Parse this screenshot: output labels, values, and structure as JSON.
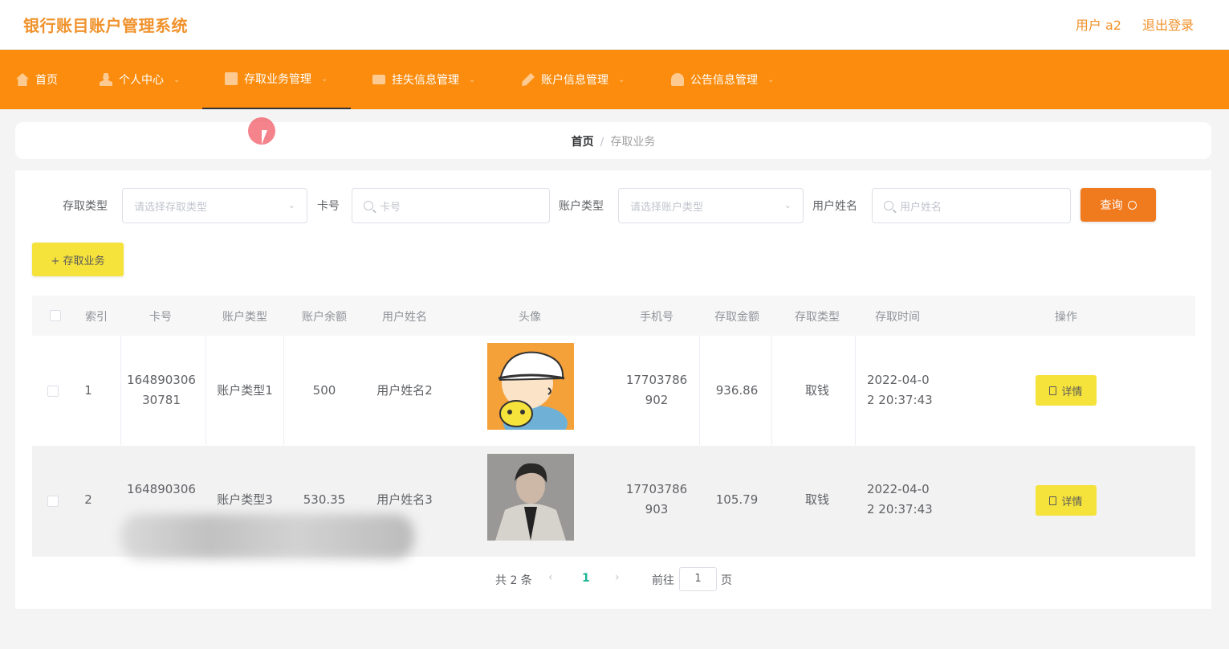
{
  "header": {
    "app_title": "银行账目账户管理系统",
    "user_label": "用户 a2",
    "logout_label": "退出登录"
  },
  "nav": {
    "items": [
      {
        "label": "首页",
        "icon": "home-icon"
      },
      {
        "label": "个人中心",
        "icon": "user-icon"
      },
      {
        "label": "存取业务管理",
        "icon": "document-icon"
      },
      {
        "label": "挂失信息管理",
        "icon": "card-icon"
      },
      {
        "label": "账户信息管理",
        "icon": "edit-icon"
      },
      {
        "label": "公告信息管理",
        "icon": "bell-icon"
      }
    ],
    "active_index": 2,
    "colors": {
      "bar": "#fb8c0d",
      "text": "#ffffff"
    }
  },
  "breadcrumb": {
    "home": "首页",
    "separator": "/",
    "current": "存取业务"
  },
  "search": {
    "type_label": "存取类型",
    "type_placeholder": "请选择存取类型",
    "card_label": "卡号",
    "card_placeholder": "卡号",
    "account_type_label": "账户类型",
    "account_type_placeholder": "请选择账户类型",
    "name_label": "用户姓名",
    "name_placeholder": "用户姓名",
    "query_label": "查询"
  },
  "add_button_label": "+ 存取业务",
  "table": {
    "headers": [
      "索引",
      "卡号",
      "账户类型",
      "账户余额",
      "用户姓名",
      "头像",
      "手机号",
      "存取金额",
      "存取类型",
      "存取时间",
      "操作"
    ],
    "rows": [
      {
        "index": "1",
        "card_line1": "164890306",
        "card_line2": "30781",
        "account_type": "账户类型1",
        "balance": "500",
        "name": "用户姓名2",
        "phone_line1": "17703786",
        "phone_line2": "902",
        "amount": "936.86",
        "op_type": "取钱",
        "time_line1": "2022-04-0",
        "time_line2": "2 20:37:43",
        "action": "详情"
      },
      {
        "index": "2",
        "card_line1": "164890306",
        "card_line2": "",
        "account_type": "账户类型3",
        "balance": "530.35",
        "name": "用户姓名3",
        "phone_line1": "17703786",
        "phone_line2": "903",
        "amount": "105.79",
        "op_type": "取钱",
        "time_line1": "2022-04-0",
        "time_line2": "2 20:37:43",
        "action": "详情"
      }
    ]
  },
  "pagination": {
    "total": "共 2 条",
    "current_page": "1",
    "goto_label": "前往",
    "goto_value": "1",
    "page_unit": "页"
  },
  "colors": {
    "accent": "#fb8c0d",
    "title": "#f0922c",
    "query_button": "#f07a1e",
    "yellow_button": "#f5e23b",
    "active_page": "#1ab394"
  }
}
